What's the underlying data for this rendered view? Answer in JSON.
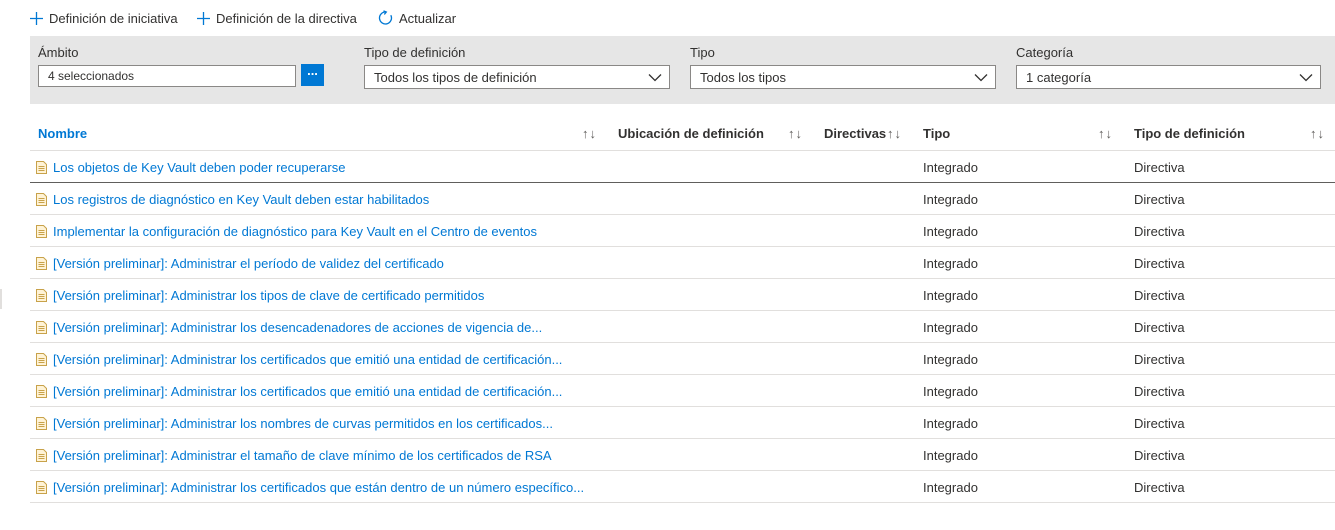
{
  "toolbar": {
    "initiative_label": "Definición de iniciativa",
    "policy_label": "Definición de la directiva",
    "refresh_label": "Actualizar"
  },
  "filters": {
    "scope_label": "Ámbito",
    "scope_value": "4 seleccionados",
    "scope_button": "...",
    "deftype_label": "Tipo de definición",
    "deftype_value": "Todos los tipos de definición",
    "type_label": "Tipo",
    "type_value": "Todos los tipos",
    "category_label": "Categoría",
    "category_value": "1 categoría"
  },
  "grid": {
    "columns": [
      "Nombre",
      "Ubicación de definición",
      "Directivas",
      "Tipo",
      "Tipo de definición"
    ],
    "sort_glyph": "↑↓",
    "rows": [
      {
        "name": "Los objetos de Key Vault deben poder recuperarse",
        "tipo": "Integrado",
        "tdef": "Directiva"
      },
      {
        "name": "Los registros de diagnóstico en Key Vault deben estar habilitados",
        "tipo": "Integrado",
        "tdef": "Directiva"
      },
      {
        "name": "Implementar la configuración de diagnóstico para Key Vault en el Centro de eventos",
        "tipo": "Integrado",
        "tdef": "Directiva"
      },
      {
        "name": "[Versión preliminar]: Administrar el período de validez del certificado",
        "tipo": "Integrado",
        "tdef": "Directiva"
      },
      {
        "name": "[Versión preliminar]: Administrar los tipos de clave de certificado permitidos",
        "tipo": "Integrado",
        "tdef": "Directiva"
      },
      {
        "name": "[Versión preliminar]: Administrar los desencadenadores de acciones de vigencia de...",
        "tipo": "Integrado",
        "tdef": "Directiva"
      },
      {
        "name": "[Versión preliminar]: Administrar los certificados que emitió una entidad de certificación...",
        "tipo": "Integrado",
        "tdef": "Directiva"
      },
      {
        "name": "[Versión preliminar]: Administrar los certificados que emitió una entidad de certificación...",
        "tipo": "Integrado",
        "tdef": "Directiva"
      },
      {
        "name": "[Versión preliminar]: Administrar los nombres de curvas permitidos en los certificados...",
        "tipo": "Integrado",
        "tdef": "Directiva"
      },
      {
        "name": "[Versión preliminar]: Administrar el tamaño de clave mínimo de los certificados de RSA",
        "tipo": "Integrado",
        "tdef": "Directiva"
      },
      {
        "name": "[Versión preliminar]: Administrar los certificados que están dentro de un número específico...",
        "tipo": "Integrado",
        "tdef": "Directiva"
      }
    ]
  },
  "colors": {
    "accent": "#0078d4",
    "filter_bar": "#e6e6e6",
    "text": "#323130",
    "doc_icon": "#c8a24a"
  },
  "icons": {
    "initiative": "plus-icon",
    "policy": "plus-icon",
    "refresh": "refresh-icon",
    "select": "chevron-down-icon",
    "row": "document-icon"
  }
}
